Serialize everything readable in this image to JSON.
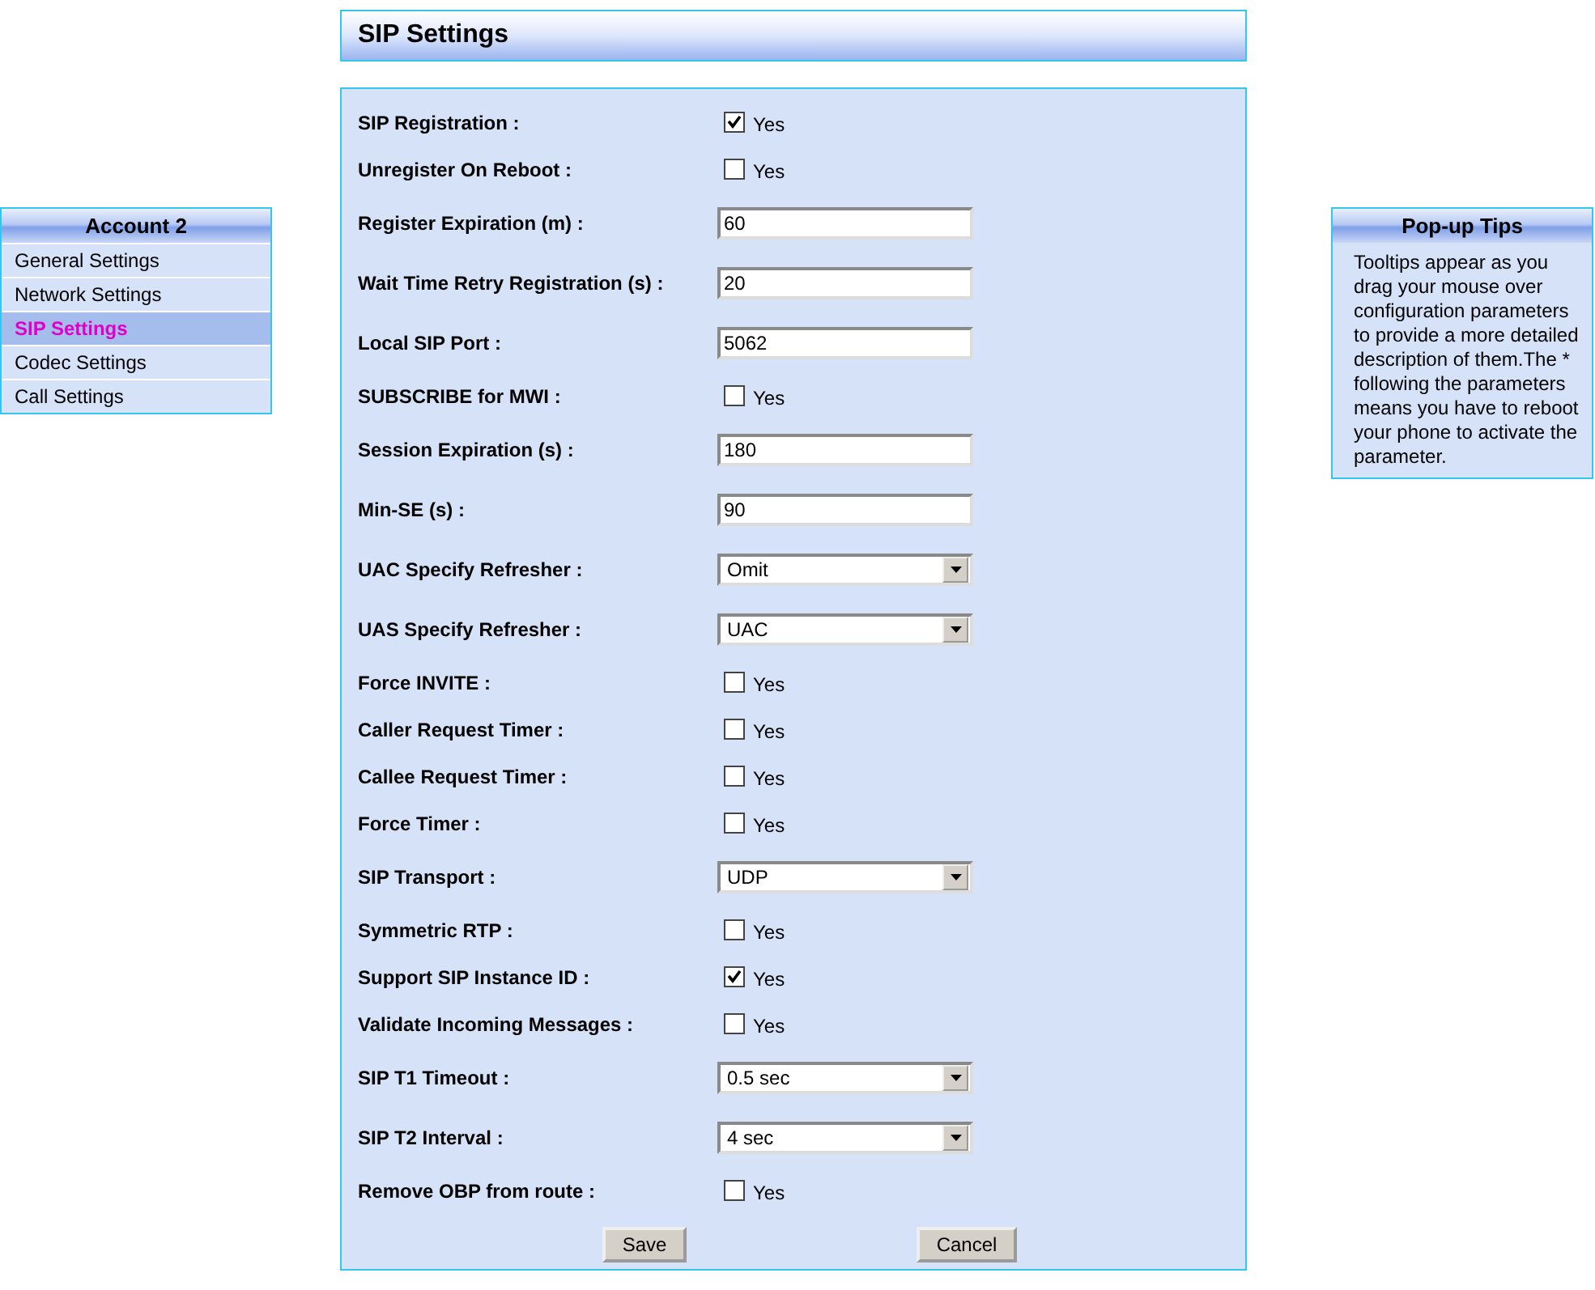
{
  "sidebar": {
    "title": "Account 2",
    "items": [
      {
        "label": "General Settings",
        "selected": false
      },
      {
        "label": "Network Settings",
        "selected": false
      },
      {
        "label": "SIP Settings",
        "selected": true
      },
      {
        "label": "Codec Settings",
        "selected": false
      },
      {
        "label": "Call Settings",
        "selected": false
      }
    ]
  },
  "page_title": "SIP Settings",
  "rows": [
    {
      "kind": "checkbox",
      "label": "SIP Registration :",
      "option": "Yes",
      "checked": true
    },
    {
      "kind": "checkbox",
      "label": "Unregister On Reboot :",
      "option": "Yes",
      "checked": false
    },
    {
      "kind": "text",
      "label": "Register Expiration (m) :",
      "value": "60"
    },
    {
      "kind": "text",
      "label": "Wait Time Retry Registration (s) :",
      "value": "20"
    },
    {
      "kind": "text",
      "label": "Local SIP Port :",
      "value": "5062"
    },
    {
      "kind": "checkbox",
      "label": "SUBSCRIBE for MWI :",
      "option": "Yes",
      "checked": false
    },
    {
      "kind": "text",
      "label": "Session Expiration (s) :",
      "value": "180"
    },
    {
      "kind": "text",
      "label": "Min-SE (s) :",
      "value": "90"
    },
    {
      "kind": "select",
      "label": "UAC Specify Refresher :",
      "value": "Omit"
    },
    {
      "kind": "select",
      "label": "UAS Specify Refresher :",
      "value": "UAC"
    },
    {
      "kind": "checkbox",
      "label": "Force INVITE :",
      "option": "Yes",
      "checked": false
    },
    {
      "kind": "checkbox",
      "label": "Caller Request Timer :",
      "option": "Yes",
      "checked": false
    },
    {
      "kind": "checkbox",
      "label": "Callee Request Timer :",
      "option": "Yes",
      "checked": false
    },
    {
      "kind": "checkbox",
      "label": "Force Timer :",
      "option": "Yes",
      "checked": false
    },
    {
      "kind": "select",
      "label": "SIP Transport :",
      "value": "UDP"
    },
    {
      "kind": "checkbox",
      "label": "Symmetric RTP :",
      "option": "Yes",
      "checked": false
    },
    {
      "kind": "checkbox",
      "label": "Support SIP Instance ID :",
      "option": "Yes",
      "checked": true
    },
    {
      "kind": "checkbox",
      "label": "Validate Incoming Messages :",
      "option": "Yes",
      "checked": false
    },
    {
      "kind": "select",
      "label": "SIP T1 Timeout :",
      "value": "0.5 sec"
    },
    {
      "kind": "select",
      "label": "SIP T2 Interval :",
      "value": "4 sec"
    },
    {
      "kind": "checkbox",
      "label": "Remove OBP from route :",
      "option": "Yes",
      "checked": false
    }
  ],
  "buttons": [
    "Save",
    "Cancel"
  ],
  "tips": {
    "title": "Pop-up Tips",
    "text": "Tooltips appear as you drag your mouse over configuration parameters to provide a more detailed description of them.The * following the parameters means you have to reboot your phone to activate the parameter."
  }
}
